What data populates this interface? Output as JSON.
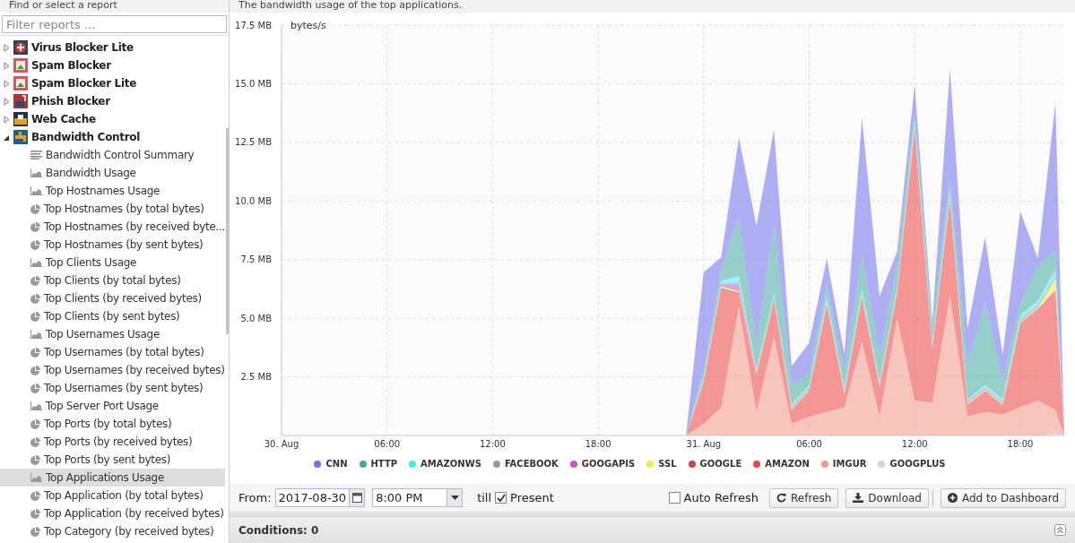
{
  "sidebar": {
    "title": "Find or select a report",
    "filter": {
      "placeholder": "Filter reports ..."
    },
    "apps": [
      {
        "name": "Virus Blocker Lite",
        "expanded": false
      },
      {
        "name": "Spam Blocker",
        "expanded": false
      },
      {
        "name": "Spam Blocker Lite",
        "expanded": false
      },
      {
        "name": "Phish Blocker",
        "expanded": false
      },
      {
        "name": "Web Cache",
        "expanded": false
      },
      {
        "name": "Bandwidth Control",
        "expanded": true,
        "children": [
          {
            "label": "Bandwidth Control Summary",
            "kind": "text",
            "selected": false
          },
          {
            "label": "Bandwidth Usage",
            "kind": "area",
            "selected": false
          },
          {
            "label": "Top Hostnames Usage",
            "kind": "area",
            "selected": false
          },
          {
            "label": "Top Hostnames (by total bytes)",
            "kind": "pie",
            "selected": false
          },
          {
            "label": "Top Hostnames (by received byte...",
            "kind": "pie",
            "selected": false
          },
          {
            "label": "Top Hostnames (by sent bytes)",
            "kind": "pie",
            "selected": false
          },
          {
            "label": "Top Clients Usage",
            "kind": "area",
            "selected": false
          },
          {
            "label": "Top Clients (by total bytes)",
            "kind": "pie",
            "selected": false
          },
          {
            "label": "Top Clients (by received bytes)",
            "kind": "pie",
            "selected": false
          },
          {
            "label": "Top Clients (by sent bytes)",
            "kind": "pie",
            "selected": false
          },
          {
            "label": "Top Usernames Usage",
            "kind": "area",
            "selected": false
          },
          {
            "label": "Top Usernames (by total bytes)",
            "kind": "pie",
            "selected": false
          },
          {
            "label": "Top Usernames (by received bytes)",
            "kind": "pie",
            "selected": false
          },
          {
            "label": "Top Usernames (by sent bytes)",
            "kind": "pie",
            "selected": false
          },
          {
            "label": "Top Server Port Usage",
            "kind": "area",
            "selected": false
          },
          {
            "label": "Top Ports (by total bytes)",
            "kind": "pie",
            "selected": false
          },
          {
            "label": "Top Ports (by received bytes)",
            "kind": "pie",
            "selected": false
          },
          {
            "label": "Top Ports (by sent bytes)",
            "kind": "pie",
            "selected": false
          },
          {
            "label": "Top Applications Usage",
            "kind": "area",
            "selected": true
          },
          {
            "label": "Top Application (by total bytes)",
            "kind": "pie",
            "selected": false
          },
          {
            "label": "Top Application (by received bytes)",
            "kind": "pie",
            "selected": false
          },
          {
            "label": "Top Category (by received bytes)",
            "kind": "pie",
            "selected": false
          }
        ]
      }
    ]
  },
  "report": {
    "description": "The bandwidth usage of the top applications.",
    "chart_data": {
      "type": "area",
      "stacked": true,
      "grid": true,
      "ylabel": "bytes/s",
      "xlim": [
        "2017-08-30T00:00",
        "2017-08-31T20:30"
      ],
      "ylim": [
        0,
        17.5
      ],
      "x": [
        "2017-08-30T00:00",
        "2017-08-30T23:00",
        "2017-08-31T00:00",
        "2017-08-31T01:00",
        "2017-08-31T02:00",
        "2017-08-31T03:00",
        "2017-08-31T04:00",
        "2017-08-31T05:00",
        "2017-08-31T06:00",
        "2017-08-31T07:00",
        "2017-08-31T08:00",
        "2017-08-31T09:00",
        "2017-08-31T10:00",
        "2017-08-31T11:00",
        "2017-08-31T12:00",
        "2017-08-31T13:00",
        "2017-08-31T14:00",
        "2017-08-31T15:00",
        "2017-08-31T16:00",
        "2017-08-31T17:00",
        "2017-08-31T18:00",
        "2017-08-31T19:00",
        "2017-08-31T20:00",
        "2017-08-31T20:30"
      ],
      "xticks": [
        {
          "value": "2017-08-30T00:00",
          "label": "30. Aug"
        },
        {
          "value": "2017-08-30T06:00",
          "label": "06:00"
        },
        {
          "value": "2017-08-30T12:00",
          "label": "12:00"
        },
        {
          "value": "2017-08-30T18:00",
          "label": "18:00"
        },
        {
          "value": "2017-08-31T00:00",
          "label": "31. Aug"
        },
        {
          "value": "2017-08-31T06:00",
          "label": "06:00"
        },
        {
          "value": "2017-08-31T12:00",
          "label": "12:00"
        },
        {
          "value": "2017-08-31T18:00",
          "label": "18:00"
        }
      ],
      "yticks": [
        {
          "value": 2.5,
          "label": "2.5 MB"
        },
        {
          "value": 5,
          "label": "5.0 MB"
        },
        {
          "value": 7.5,
          "label": "7.5 MB"
        },
        {
          "value": 10,
          "label": "10.0 MB"
        },
        {
          "value": 12.5,
          "label": "12.5 MB"
        },
        {
          "value": 15,
          "label": "15.0 MB"
        },
        {
          "value": 17.5,
          "label": "17.5 MB"
        }
      ],
      "series": [
        {
          "name": "GOOGPLUS",
          "color": "#d5d5d5",
          "values": [
            0,
            0,
            0,
            0,
            0,
            0,
            0,
            0,
            0,
            0,
            0,
            0,
            0,
            0,
            0,
            0,
            0,
            0,
            0,
            0,
            0,
            0,
            0.1,
            0
          ]
        },
        {
          "name": "IMGUR",
          "color": "#f39a88",
          "values": [
            0,
            0,
            0.5,
            1.2,
            5.5,
            1,
            4.2,
            0.5,
            0.8,
            1,
            1.2,
            4,
            0.8,
            5,
            1.5,
            1.4,
            6,
            0.8,
            1,
            0.9,
            1.2,
            1.5,
            1,
            0
          ]
        },
        {
          "name": "AMAZON",
          "color": "#ee4444",
          "values": [
            0,
            0,
            1.7,
            5,
            0.5,
            1.5,
            1.5,
            0.5,
            1,
            4.5,
            0.5,
            1.8,
            1.2,
            1,
            11.5,
            2.2,
            4,
            0.4,
            0.8,
            0.3,
            3.5,
            3.8,
            5,
            0
          ]
        },
        {
          "name": "GOOGLE",
          "color": "#cc4444",
          "values": [
            0,
            0,
            0.1,
            0.1,
            0.1,
            0.1,
            0.1,
            0.1,
            0.1,
            0.1,
            0.1,
            0.1,
            0.1,
            0.1,
            0.1,
            0.1,
            0.1,
            0.1,
            0.1,
            0.1,
            0.1,
            0.1,
            0.1,
            0
          ]
        },
        {
          "name": "SSL",
          "color": "#eeee44",
          "values": [
            0,
            0,
            0.05,
            0.05,
            0.05,
            0.05,
            0.05,
            0.05,
            0.05,
            0.05,
            0.05,
            0.05,
            0.05,
            0.05,
            0.05,
            0.05,
            0.05,
            0.05,
            0.05,
            0.05,
            0.05,
            0.05,
            0.5,
            0
          ]
        },
        {
          "name": "GOOGAPIS",
          "color": "#cc55cc",
          "values": [
            0,
            0,
            0.05,
            0.1,
            0.3,
            0.05,
            0.05,
            0.05,
            0.05,
            0.05,
            0.05,
            0.05,
            0.05,
            0.05,
            0.05,
            0.05,
            0.05,
            0.05,
            0.05,
            0.05,
            0.05,
            0.05,
            0.05,
            0
          ]
        },
        {
          "name": "FACEBOOK",
          "color": "#999999",
          "values": [
            0,
            0,
            0.05,
            0.05,
            0.05,
            0.05,
            0.05,
            0.05,
            0.05,
            0.05,
            0.05,
            0.05,
            0.05,
            0.05,
            0.05,
            0.05,
            0.05,
            0.05,
            0.05,
            0.05,
            0.05,
            0.05,
            0.05,
            0
          ]
        },
        {
          "name": "AMAZONWS",
          "color": "#44eeee",
          "values": [
            0,
            0,
            0.1,
            0.1,
            0.3,
            0.1,
            0.1,
            0.1,
            0.1,
            0.2,
            0.1,
            0.2,
            0.1,
            0.1,
            0.3,
            0.1,
            0.3,
            0.1,
            0.1,
            0.1,
            0.2,
            0.2,
            0.3,
            0
          ]
        },
        {
          "name": "HTTP",
          "color": "#44aaa0",
          "values": [
            0,
            0,
            0.3,
            0.5,
            2.5,
            1,
            3,
            0.8,
            0.5,
            0.5,
            0.7,
            1.5,
            1,
            1,
            0.3,
            0.7,
            0.5,
            1.5,
            3.5,
            0.8,
            0.5,
            1.5,
            0.8,
            0
          ]
        },
        {
          "name": "CNN",
          "color": "#7070f0",
          "values": [
            0,
            0,
            4.1,
            0.5,
            3.4,
            5.1,
            4,
            0.8,
            1.3,
            1.1,
            0.7,
            5.8,
            2.6,
            0.5,
            1.1,
            0.2,
            4.6,
            1.5,
            2.8,
            1.1,
            3.9,
            0.3,
            6.3,
            0
          ]
        }
      ]
    }
  },
  "toolbar": {
    "from_label": "From:",
    "date": "2017-08-30",
    "time": "8:00 PM",
    "till_label": "till",
    "present": {
      "label": "Present",
      "checked": true
    },
    "auto_refresh": {
      "label": "Auto Refresh",
      "checked": false
    },
    "buttons": [
      {
        "label": "Refresh",
        "kind": "refresh"
      },
      {
        "label": "Download",
        "kind": "download"
      },
      {
        "label": "Add to Dashboard",
        "kind": "add"
      }
    ]
  },
  "conditions": {
    "label": "Conditions: 0"
  }
}
